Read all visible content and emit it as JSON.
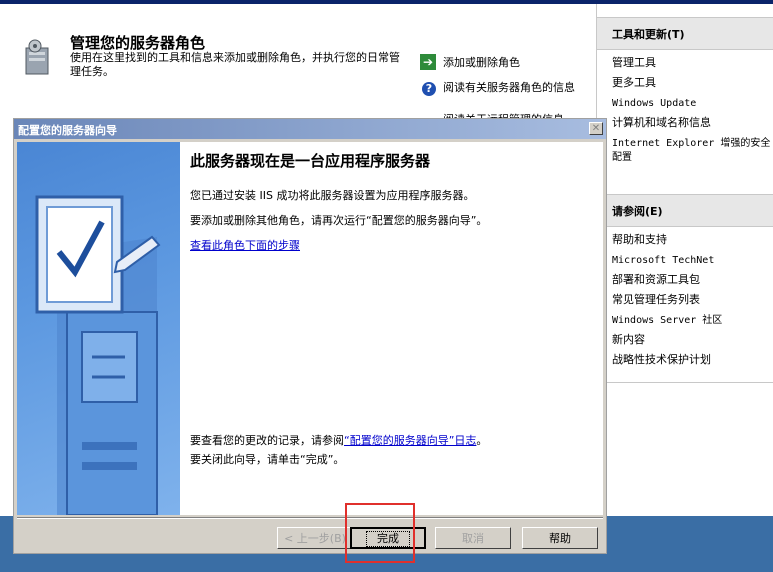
{
  "background": {
    "title": "管理您的服务器角色",
    "description": "使用在这里找到的工具和信息来添加或删除角色，并执行您的日常管理任务。",
    "links": {
      "add_remove": "添加或删除角色",
      "read_more": "阅读有关服务器角色的信息",
      "remote": "阅读关于远程管理的信息"
    }
  },
  "right_panel": {
    "tools_header": "工具和更新(T)",
    "tools_items": [
      "管理工具",
      "更多工具",
      "Windows Update",
      "计算机和域名称信息",
      "Internet Explorer 增强的安全配置"
    ],
    "see_also_header": "请参阅(E)",
    "see_also_items": [
      "帮助和支持",
      "Microsoft TechNet",
      "部署和资源工具包",
      "常见管理任务列表",
      "Windows Server 社区",
      "新内容",
      "战略性技术保护计划"
    ]
  },
  "wizard": {
    "title": "配置您的服务器向导",
    "close_glyph": "✕",
    "heading": "此服务器现在是一台应用程序服务器",
    "p1": "您已通过安装 IIS 成功将此服务器设置为应用程序服务器。",
    "p2": "要添加或删除其他角色，请再次运行“配置您的服务器向导”。",
    "steps_link": "查看此角色下面的步骤",
    "log_prefix": "要查看您的更改的记录，请参阅",
    "log_link": "“配置您的服务器向导”日志",
    "log_suffix": "。",
    "close_instruction": "要关闭此向导，请单击“完成”。",
    "buttons": {
      "back": "< 上一步(B)",
      "finish": "完成",
      "cancel": "取消",
      "help": "帮助"
    }
  },
  "colors": {
    "highlight_box": "#e0302c",
    "taskbar": "#3a6ea5",
    "link": "#0000cc"
  }
}
